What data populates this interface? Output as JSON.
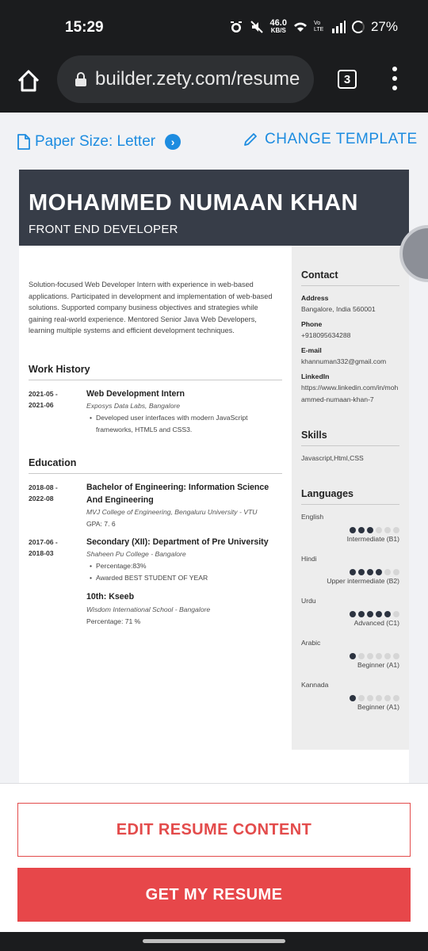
{
  "status": {
    "time": "15:29",
    "speed": "46.0",
    "speed_unit": "KB/S",
    "volte": "Vo LTE",
    "battery": "27%"
  },
  "browser": {
    "url": "builder.zety.com/resume",
    "tab_count": "3"
  },
  "toolbar": {
    "paper_size": "Paper Size: Letter",
    "change_template": "CHANGE TEMPLATE"
  },
  "resume": {
    "name": "MOHAMMED NUMAAN KHAN",
    "title": "FRONT END DEVELOPER",
    "summary": "Solution-focused Web Developer Intern with experience in web-based applications. Participated in development and implementation of web-based solutions. Supported company business objectives and strategies while gaining real-world experience. Mentored Senior Java Web Developers, learning multiple systems and efficient development techniques.",
    "work_heading": "Work History",
    "work": [
      {
        "start": "2021-05 -",
        "end": "2021-06",
        "title": "Web Development Intern",
        "company": "Exposys Data Labs, Bangalore",
        "bullet": "Developed user interfaces with modern JavaScript frameworks, HTML5 and CSS3."
      }
    ],
    "education_heading": "Education",
    "education": [
      {
        "start": "2018-08 -",
        "end": "2022-08",
        "title": "Bachelor of Engineering: Information Science And Engineering",
        "school": "MVJ College of Engineering, Bengaluru University - VTU",
        "line": "GPA: 7. 6"
      },
      {
        "start": "2017-06 -",
        "end": "2018-03",
        "title": "Secondary (XII): Department of Pre University",
        "school": "Shaheen Pu College - Bangalore",
        "bullet1": "Percentage:83%",
        "bullet2": "Awarded BEST STUDENT OF YEAR"
      },
      {
        "title": "10th: Kseeb",
        "school": "Wisdom International School - Bangalore",
        "line": "Percentage: 71 %"
      }
    ],
    "contact_heading": "Contact",
    "address_label": "Address",
    "address": "Bangalore, India 560001",
    "phone_label": "Phone",
    "phone": "+918095634288",
    "email_label": "E-mail",
    "email": "khannuman332@gmail.com",
    "linkedin_label": "LinkedIn",
    "linkedin": "https://www.linkedin.com/in/mohammed-numaan-khan-7",
    "skills_heading": "Skills",
    "skills": "Javascript,Html,CSS",
    "languages_heading": "Languages",
    "languages": [
      {
        "name": "English",
        "level": "Intermediate (B1)",
        "filled": 3
      },
      {
        "name": "Hindi",
        "level": "Upper intermediate (B2)",
        "filled": 4
      },
      {
        "name": "Urdu",
        "level": "Advanced (C1)",
        "filled": 5
      },
      {
        "name": "Arabic",
        "level": "Beginner (A1)",
        "filled": 1
      },
      {
        "name": "Kannada",
        "level": "Beginner (A1)",
        "filled": 1
      }
    ]
  },
  "actions": {
    "edit": "EDIT RESUME CONTENT",
    "get": "GET MY RESUME"
  },
  "colors": {
    "accent": "#1d8ce0",
    "header_bg": "#373d48",
    "cta": "#e7474a"
  }
}
